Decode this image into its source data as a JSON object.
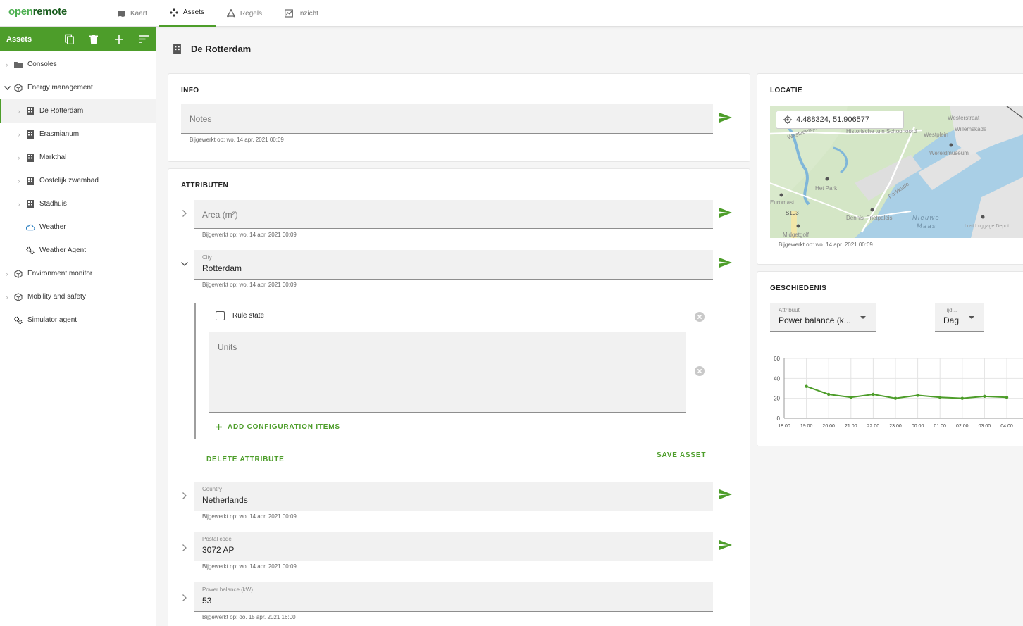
{
  "app": {
    "logo_part1": "open",
    "logo_part2": "remote"
  },
  "nav": [
    {
      "label": "Kaart",
      "icon": "map-icon"
    },
    {
      "label": "Assets",
      "icon": "assets-icon"
    },
    {
      "label": "Regels",
      "icon": "rules-icon"
    },
    {
      "label": "Inzicht",
      "icon": "insights-icon"
    }
  ],
  "sidebar": {
    "title": "Assets",
    "items": [
      {
        "label": "Consoles",
        "icon": "folder-icon"
      },
      {
        "label": "Energy management",
        "icon": "cube-icon"
      },
      {
        "label": "De Rotterdam",
        "icon": "building-icon"
      },
      {
        "label": "Erasmianum",
        "icon": "building-icon"
      },
      {
        "label": "Markthal",
        "icon": "building-icon"
      },
      {
        "label": "Oostelijk zwembad",
        "icon": "building-icon"
      },
      {
        "label": "Stadhuis",
        "icon": "building-icon"
      },
      {
        "label": "Weather",
        "icon": "weather-icon"
      },
      {
        "label": "Weather Agent",
        "icon": "agent-icon"
      },
      {
        "label": "Environment monitor",
        "icon": "cube-icon"
      },
      {
        "label": "Mobility and safety",
        "icon": "cube-icon"
      },
      {
        "label": "Simulator agent",
        "icon": "agent-icon"
      }
    ]
  },
  "asset": {
    "name": "De Rotterdam"
  },
  "info": {
    "title": "INFO",
    "notes_placeholder": "Notes",
    "updated": "Bijgewerkt op: wo. 14 apr. 2021 00:09"
  },
  "attributes": {
    "title": "ATTRIBUTEN",
    "area": {
      "placeholder": "Area (m²)",
      "updated": "Bijgewerkt op: wo. 14 apr. 2021 00:09"
    },
    "city": {
      "label": "City",
      "value": "Rotterdam",
      "updated": "Bijgewerkt op: wo. 14 apr. 2021 00:09"
    },
    "rule_state_label": "Rule state",
    "units_placeholder": "Units",
    "add_config": "ADD CONFIGURATION ITEMS",
    "delete_attribute": "DELETE ATTRIBUTE",
    "save_asset": "SAVE ASSET",
    "country": {
      "label": "Country",
      "value": "Netherlands",
      "updated": "Bijgewerkt op: wo. 14 apr. 2021 00:09"
    },
    "postal": {
      "label": "Postal code",
      "value": "3072 AP",
      "updated": "Bijgewerkt op: wo. 14 apr. 2021 00:09"
    },
    "power": {
      "label": "Power balance (kW)",
      "value": "53",
      "updated": "Bijgewerkt op: do. 15 apr. 2021 16:00"
    }
  },
  "location": {
    "title": "LOCATIE",
    "coords": "4.488324, 51.906577",
    "updated": "Bijgewerkt op: wo. 14 apr. 2021 00:09",
    "labels": [
      "Historische tuin Schoonoord",
      "Westplein",
      "Westerstraat",
      "Willemskade",
      "Wereldmuseum",
      "Het Park",
      "Euromast",
      "S103",
      "Dennis' Frietpaleis",
      "Nieuwe",
      "Maas",
      "Lost Luggage Depot",
      "Midgetgolf",
      "Westzeedijk",
      "Parkkade"
    ]
  },
  "history": {
    "title": "GESCHIEDENIS",
    "attr_label": "Attribuut",
    "attr_value": "Power balance (k...",
    "time_label": "Tijd...",
    "time_value": "Dag"
  },
  "chart_data": {
    "type": "line",
    "title": "",
    "xlabel": "",
    "ylabel": "",
    "x": [
      "18:00",
      "19:00",
      "20:00",
      "21:00",
      "22:00",
      "23:00",
      "00:00",
      "01:00",
      "02:00",
      "03:00",
      "04:00"
    ],
    "series": [
      {
        "values": [
          null,
          32,
          24,
          21,
          24,
          20,
          23,
          21,
          20,
          22,
          21
        ]
      }
    ],
    "yticks": [
      0,
      20,
      40,
      60
    ],
    "ylim": [
      0,
      60
    ],
    "grid": true,
    "color": "#4d9d2a"
  },
  "colors": {
    "primary": "#4d9d2a",
    "water": "#a9cfe6",
    "park": "#cfe3c2"
  }
}
